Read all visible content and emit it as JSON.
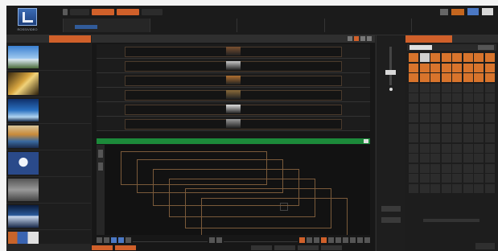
{
  "app": {
    "logo_text": "ROSS/VIDEO"
  },
  "colors": {
    "accent": "#d0602a",
    "green_bar": "#1c8a3a",
    "panel": "#1d1d1d",
    "frame": "#7a5a3a"
  },
  "top": {
    "modes": [
      "",
      "",
      "",
      "",
      ""
    ],
    "presets": [
      {
        "label": "",
        "sub": ""
      },
      {
        "label": "",
        "sub": ""
      },
      {
        "label": "",
        "sub": ""
      },
      {
        "label": "",
        "sub": ""
      },
      {
        "label": "",
        "sub": ""
      }
    ]
  },
  "left": {
    "tabs": [
      "",
      ""
    ],
    "media": [
      {
        "title": "",
        "line1": "",
        "line2": "",
        "thumb": "sky"
      },
      {
        "title": "",
        "line1": "",
        "line2": "",
        "thumb": "gold"
      },
      {
        "title": "",
        "line1": "",
        "line2": "",
        "thumb": "blue"
      },
      {
        "title": "",
        "line1": "",
        "line2": "",
        "thumb": "ocean"
      },
      {
        "title": "",
        "line1": "",
        "line2": "",
        "thumb": "icon"
      },
      {
        "title": "",
        "line1": "",
        "line2": "",
        "thumb": "grey"
      },
      {
        "title": "",
        "line1": "",
        "line2": "",
        "thumb": "city"
      },
      {
        "title": "",
        "line1": "",
        "line2": "",
        "thumb": "mixed"
      }
    ]
  },
  "center": {
    "title": "",
    "layer_count": 6,
    "toolbar_label": ""
  },
  "audio": {
    "level": 0.3,
    "value_text": "",
    "btn_labels": [
      "",
      ""
    ]
  },
  "right": {
    "tabs": [
      "",
      ""
    ],
    "grid_rows": 14,
    "grid_cols": 8,
    "active_rows": 3
  }
}
